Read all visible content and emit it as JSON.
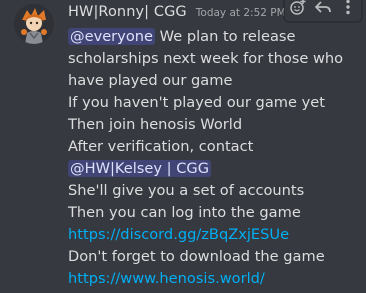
{
  "message": {
    "username": "HW|Ronny| CGG",
    "timestamp": "Today at 2:52 PM",
    "lines": [
      {
        "type": "mention_text",
        "mention": "@everyone",
        "text": " We plan to release"
      },
      {
        "type": "text",
        "text": "scholarships next week for those who"
      },
      {
        "type": "text",
        "text": "have played our game"
      },
      {
        "type": "text",
        "text": "If you haven't played our game yet"
      },
      {
        "type": "text",
        "text": "Then join henosis World"
      },
      {
        "type": "text",
        "text": "After verification, contact"
      },
      {
        "type": "mention",
        "mention": "@HW|Kelsey | CGG"
      },
      {
        "type": "text",
        "text": "She'll give you a set of accounts"
      },
      {
        "type": "text",
        "text": "Then you can log into the game"
      },
      {
        "type": "link",
        "text": "https://discord.gg/zBqZxjESUe"
      },
      {
        "type": "text",
        "text": "Don't forget to download the game"
      },
      {
        "type": "link",
        "text": "https://www.henosis.world/"
      }
    ]
  },
  "toolbar": {
    "icons": [
      "add-reaction-icon",
      "reply-icon",
      "more-options-icon"
    ]
  },
  "colors": {
    "background": "#36393f",
    "text": "#dcddde",
    "link": "#00aff4",
    "mention_bg": "#4b5190",
    "timestamp": "#a3a6aa"
  }
}
